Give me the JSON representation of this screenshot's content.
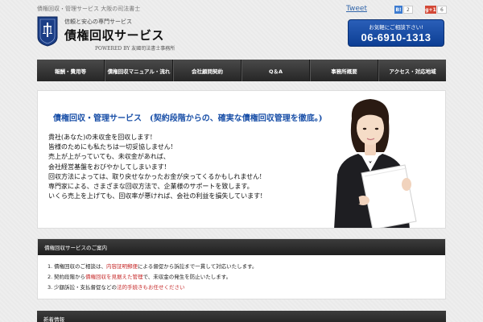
{
  "header": {
    "topline": "債権回収・管理サービス 大阪の司法書士",
    "tagline": "信頼と安心の専門サービス",
    "brand": "債権回収サービス",
    "powered": "POWERED BY 友國司法書士事務所"
  },
  "social": {
    "tweet": "Tweet",
    "b_count": "2",
    "g_label": "g+1",
    "g_count": "6"
  },
  "contact": {
    "label": "お気軽にご相談下さい!",
    "phone": "06-6910-1313"
  },
  "nav": [
    "報酬・費用等",
    "債権回収マニュアル・流れ",
    "会社顧問契約",
    "Q＆A",
    "事務所概要",
    "アクセス・対応地域"
  ],
  "hero": {
    "title": "債権回収・管理サービス　(契約段階からの、確実な債権回収管理を徹底。)",
    "lines": [
      "貴社(あなた)の未収金を回収します!",
      "皆様のためにも私たちは一切妥協しません!",
      "売上が上がっていても、未収金があれば、",
      "会社経営基盤をおびやかしてしまいます!",
      "回収方法によっては、取り戻せなかったお金が戻ってくるかもしれません!",
      "専門家による、さまざまな回収方法で、企業様のサポートを致します。",
      "いくら売上を上げても、回収率が悪ければ、会社の利益を損失しています!"
    ]
  },
  "panel": {
    "heading": "債権回収サービスのご案内",
    "items": [
      {
        "num": "1.",
        "pre": "債権回収のご相談は、",
        "red": "内容証明郵便",
        "post": "による督促から訴訟まで一貫して対応いたします。"
      },
      {
        "num": "2.",
        "pre": "契約段階から",
        "red": "債権回収を見据えた管理",
        "post": "で、未収金の発生を防止いたします。"
      },
      {
        "num": "3.",
        "pre": "少額訴訟・支払督促などの",
        "red": "法的手続きもお任せください",
        "post": ""
      }
    ]
  },
  "panel2": {
    "heading": "新着情報"
  },
  "colors": {
    "accent": "#1a50a8",
    "nav_bg": "#333333",
    "phone_bg": "#1a4fa5",
    "highlight_red": "#c62a2a"
  }
}
